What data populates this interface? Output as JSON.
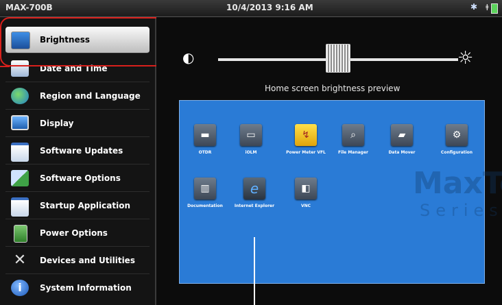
{
  "status_bar": {
    "model": "MAX-700B",
    "datetime": "10/4/2013 9:16 AM",
    "bluetooth_icon": "bluetooth-icon",
    "battery_icon": "battery-charging-icon"
  },
  "sidebar": {
    "items": [
      {
        "label": "Brightness",
        "icon": "monitor-icon",
        "selected": true
      },
      {
        "label": "Date and Time",
        "icon": "calendar-icon"
      },
      {
        "label": "Region and Language",
        "icon": "globe-icon"
      },
      {
        "label": "Display",
        "icon": "display-icon"
      },
      {
        "label": "Software Updates",
        "icon": "software-update-icon"
      },
      {
        "label": "Software Options",
        "icon": "puzzle-icon"
      },
      {
        "label": "Startup Application",
        "icon": "startup-icon"
      },
      {
        "label": "Power Options",
        "icon": "battery-icon"
      },
      {
        "label": "Devices and Utilities",
        "icon": "tools-icon"
      },
      {
        "label": "System Information",
        "icon": "info-icon"
      }
    ]
  },
  "brightness": {
    "level": 0.5,
    "low_icon": "half-sun-icon",
    "high_icon": "sun-icon",
    "preview_label": "Home screen brightness preview"
  },
  "preview": {
    "watermark_top": "MaxTester",
    "watermark_bottom": "Series",
    "apps": [
      {
        "label": "OTDR",
        "icon": "otdr-icon"
      },
      {
        "label": "iOLM",
        "icon": "iolm-icon"
      },
      {
        "label": "Power Meter VFL",
        "icon": "power-meter-icon"
      },
      {
        "label": "File Manager",
        "icon": "file-manager-icon"
      },
      {
        "label": "Data Mover",
        "icon": "data-mover-icon"
      },
      {
        "label": "Configuration",
        "icon": "gear-icon"
      },
      {
        "label": "Documentation",
        "icon": "documentation-icon"
      },
      {
        "label": "Internet Explorer",
        "icon": "internet-explorer-icon"
      },
      {
        "label": "VNC",
        "icon": "vnc-icon"
      }
    ]
  },
  "colors": {
    "accent_callout": "#d9201c",
    "preview_bg": "#2a7bd6"
  }
}
